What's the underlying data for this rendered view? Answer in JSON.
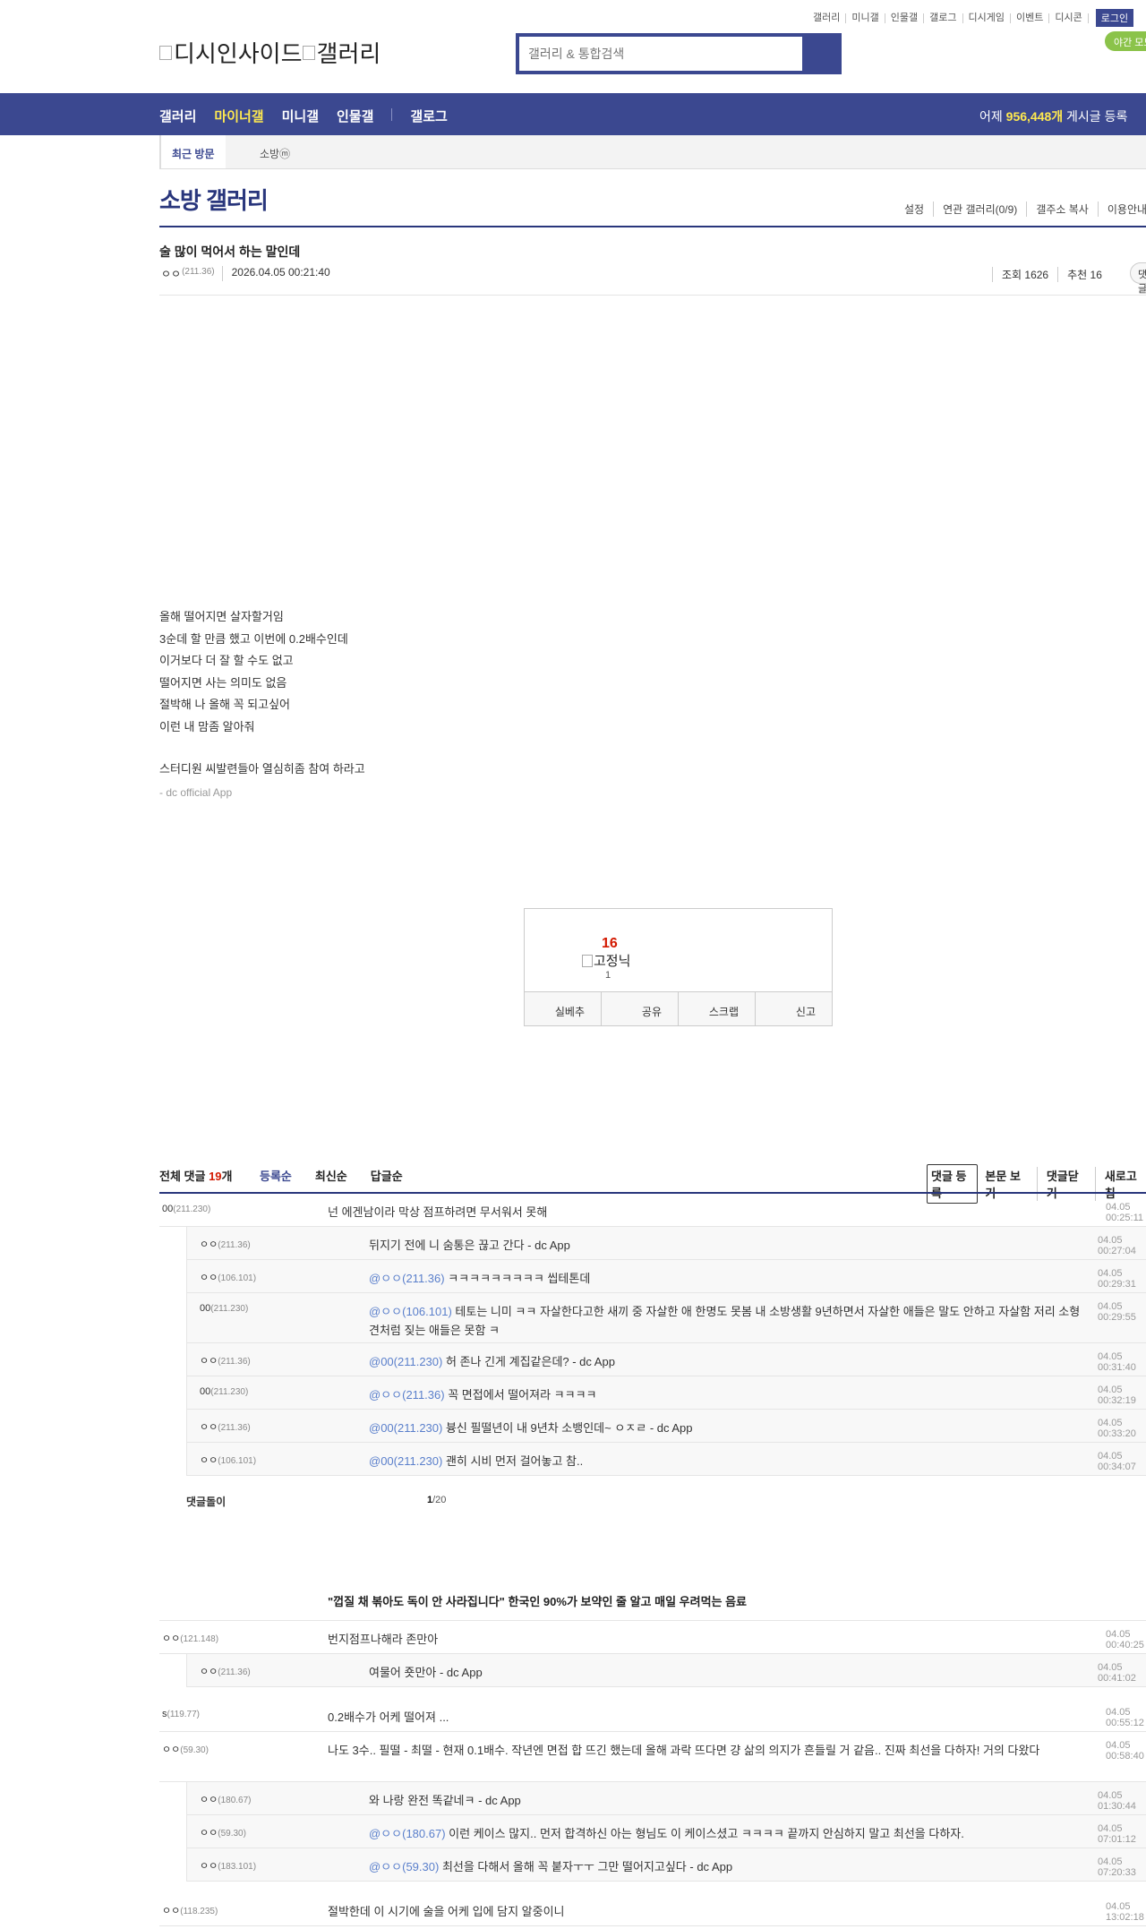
{
  "header": {
    "top_links": [
      "갤러리",
      "미니갤",
      "인물갤",
      "갤로그",
      "디시게임",
      "이벤트",
      "디시콘"
    ],
    "login": "로그인",
    "night_mode": "야간 모드",
    "logo_text": "디시인사이드갤러리",
    "logo_a": "디시인사이드",
    "logo_b": "갤러리",
    "search_placeholder": "갤러리 & 통합검색"
  },
  "nav": {
    "items": [
      "갤러리",
      "마이너갤",
      "미니갤",
      "인물갤",
      "갤로그"
    ],
    "stat_prefix": "어제",
    "stat_value": "956,448개",
    "stat_suffix": "게시글 등록"
  },
  "visit": {
    "label": "최근 방문",
    "gallery": "소방ⓜ"
  },
  "gallery": {
    "title": "소방 갤러리",
    "menu": [
      "설정",
      "연관 갤러리(0/9)",
      "갤주소 복사",
      "이용안내"
    ]
  },
  "post": {
    "title": "술 많이 먹어서 하는 말인데",
    "author": "ㅇㅇ",
    "ip": "(211.36)",
    "date": "2026.04.05 00:21:40",
    "views": "조회 1626",
    "recommend": "추천 16",
    "round_btn": "댓글",
    "body": [
      "올해 떨어지면 살자할거임",
      "3순데 할 만큼 했고 이번에 0.2배수인데",
      "이거보다 더 잘 할 수도 없고",
      "떨어지면 사는 의미도 없음",
      "절박해 나 올해 꼭 되고싶어",
      "이런 내 맘좀 알아줘"
    ],
    "extra": "스터디원 씨발련들아 열심히좀 참여 하라고",
    "app": "- dc official App"
  },
  "reco": {
    "count": "16",
    "fixed_label": "고정닉",
    "fixed_count": "1",
    "buttons": [
      "실베추",
      "공유",
      "스크랩",
      "신고"
    ]
  },
  "comments_head": {
    "total_label": "전체 댓글",
    "total_count": "19",
    "total_unit": "개",
    "sorts": [
      "등록순",
      "최신순",
      "답글순"
    ],
    "register": "댓글 등록",
    "view_body": "본문 보기",
    "close": "댓글닫기",
    "refresh": "새로고침"
  },
  "comments": [
    {
      "nick": "00",
      "ip": "(211.230)",
      "text": "넌 에겐남이라 막상 점프하려면 무서워서 못해",
      "time": "04.05 00:25:11"
    },
    {
      "nick": "ㅇㅇ",
      "ip": "(211.36)",
      "mention": "",
      "text": "뒤지기 전에 니 숨통은 끊고 간다 - dc App",
      "time": "04.05 00:27:04"
    },
    {
      "nick": "ㅇㅇ",
      "ip": "(106.101)",
      "mention": "@ㅇㅇ(211.36)",
      "text": "ㅋㅋㅋㅋㅋㅋㅋㅋㅋ 씹테톤데",
      "time": "04.05 00:29:31"
    },
    {
      "nick": "00",
      "ip": "(211.230)",
      "mention": "@ㅇㅇ(106.101)",
      "text": "테토는 니미 ㅋㅋ 자살한다고한 새끼 중 자살한 애 한명도 못봄 내 소방생활 9년하면서 자살한 애들은 말도 안하고 자살함 저리 소형견처럼 짖는 애들은 못함 ㅋ",
      "time": "04.05 00:29:55"
    },
    {
      "nick": "ㅇㅇ",
      "ip": "(211.36)",
      "mention": "@00(211.230)",
      "text": "허 존나 긴게 계집같은데? - dc App",
      "time": "04.05 00:31:40"
    },
    {
      "nick": "00",
      "ip": "(211.230)",
      "mention": "@ㅇㅇ(211.36)",
      "text": "꼭 면접에서 떨어져라 ㅋㅋㅋㅋ",
      "time": "04.05 00:32:19"
    },
    {
      "nick": "ㅇㅇ",
      "ip": "(211.36)",
      "mention": "@00(211.230)",
      "text": "븅신 필떨년이 내 9년차 소뱅인데~ ㅇㅈㄹ - dc App",
      "time": "04.05 00:33:20"
    },
    {
      "nick": "ㅇㅇ",
      "ip": "(106.101)",
      "mention": "@00(211.230)",
      "text": "괜히 시비 먼저 걸어놓고 참..",
      "time": "04.05 00:34:07"
    },
    {
      "nick": "ㅇㅇ",
      "ip": "(121.148)",
      "text": "번지점프나해라 존만아",
      "time": "04.05 00:40:25"
    },
    {
      "nick": "ㅇㅇ",
      "ip": "(211.36)",
      "mention": "",
      "text": "여물어 죳만아 - dc App",
      "time": "04.05 00:41:02"
    },
    {
      "nick": "s",
      "ip": "(119.77)",
      "text": "0.2배수가 어케 떨어져 ...",
      "time": "04.05 00:55:12"
    },
    {
      "nick": "ㅇㅇ",
      "ip": "(59.30)",
      "text": "나도 3수.. 필떨 - 최떨 - 현재 0.1배수. 작년엔 면접 합 뜨긴 했는데 올해 과락 뜨다면 걍 삶의 의지가 흔들릴 거 같음.. 진짜 최선을 다하자! 거의 다왔다",
      "time": "04.05 00:58:40"
    },
    {
      "nick": "ㅇㅇ",
      "ip": "(180.67)",
      "mention": "",
      "text": "와 나랑 완전 똑같네ㅋ - dc App",
      "time": "04.05 01:30:44"
    },
    {
      "nick": "ㅇㅇ",
      "ip": "(59.30)",
      "mention": "@ㅇㅇ(180.67)",
      "text": "이런 케이스 많지.. 먼저 합격하신 아는 형님도 이 케이스셨고 ㅋㅋㅋㅋ 끝까지 안심하지 말고 최선을 다하자.",
      "time": "04.05 07:01:12"
    },
    {
      "nick": "ㅇㅇ",
      "ip": "(183.101)",
      "mention": "@ㅇㅇ(59.30)",
      "text": "최선을 다해서 올해 꼭 붙자ㅜㅜ 그만 떨어지고싶다 - dc App",
      "time": "04.05 07:20:33"
    },
    {
      "nick": "ㅇㅇ",
      "ip": "(118.235)",
      "text": "절박한데 이 시기에 술을 어케 입에 담지 알중이니",
      "time": "04.05 13:02:18"
    }
  ],
  "pager": {
    "label": "댓글돌이",
    "current": "1",
    "total": "/20"
  },
  "news": "\"껍질 채 볶아도 독이 안 사라집니다\" 한국인 90%가 보약인 줄 알고 매일 우려먹는 음료"
}
